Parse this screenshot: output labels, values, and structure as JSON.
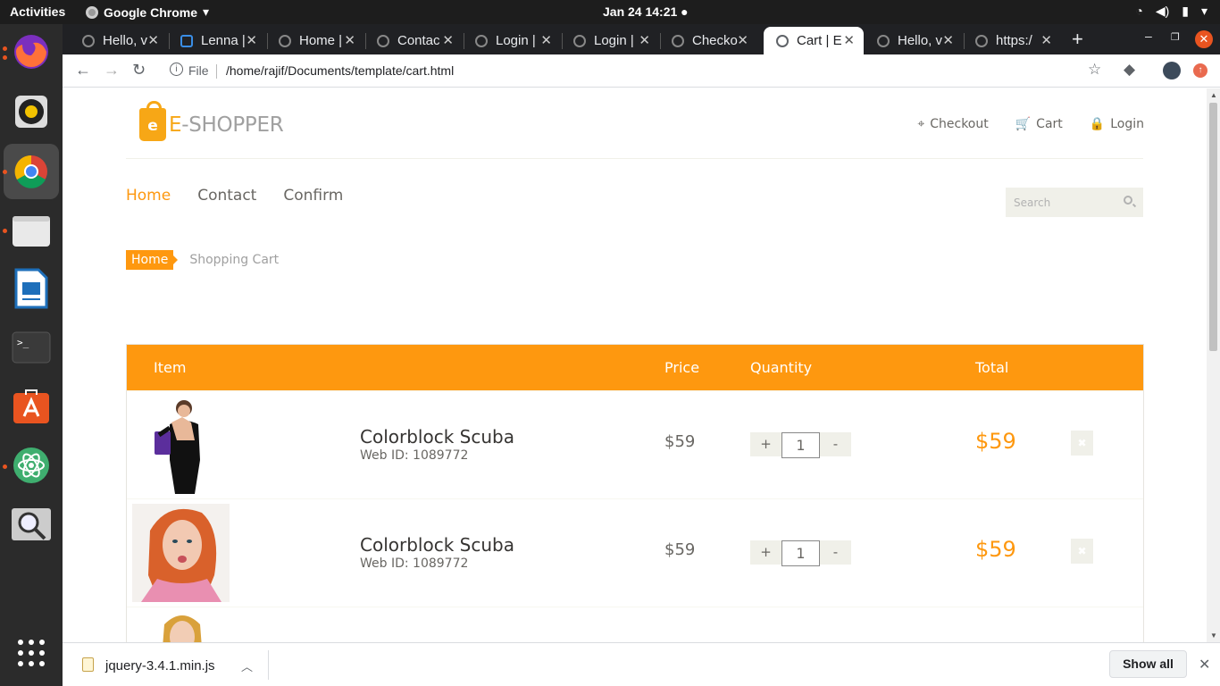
{
  "os": {
    "activities": "Activities",
    "app_name": "Google Chrome",
    "clock": "Jan 24  14:21"
  },
  "browser": {
    "tabs": [
      {
        "label": "Hello, v"
      },
      {
        "label": "Lenna |"
      },
      {
        "label": "Home |"
      },
      {
        "label": "Contac"
      },
      {
        "label": "Login |"
      },
      {
        "label": "Login |"
      },
      {
        "label": "Checko"
      },
      {
        "label": "Cart | E"
      },
      {
        "label": "Hello, v"
      },
      {
        "label": "https:/"
      }
    ],
    "active_tab_index": 7,
    "omnibox_scheme": "File",
    "url": "/home/rajif/Documents/template/cart.html"
  },
  "site": {
    "logo_letter": "e",
    "brand_first": "E",
    "brand_rest": "-SHOPPER",
    "shop_menu": {
      "checkout": "Checkout",
      "cart": "Cart",
      "login": "Login"
    },
    "main_menu": {
      "home": "Home",
      "contact": "Contact",
      "confirm": "Confirm"
    },
    "search_placeholder": "Search",
    "breadcrumb": {
      "home": "Home",
      "current": "Shopping Cart"
    },
    "accent_color": "#fe980f"
  },
  "cart": {
    "headers": {
      "item": "Item",
      "price": "Price",
      "quantity": "Quantity",
      "total": "Total"
    },
    "rows": [
      {
        "name": "Colorblock Scuba",
        "web_id": "Web ID: 1089772",
        "price": "$59",
        "qty": "1",
        "total": "$59",
        "plus": "+",
        "minus": "-"
      },
      {
        "name": "Colorblock Scuba",
        "web_id": "Web ID: 1089772",
        "price": "$59",
        "qty": "1",
        "total": "$59",
        "plus": "+",
        "minus": "-"
      }
    ]
  },
  "downloads": {
    "file": "jquery-3.4.1.min.js",
    "show_all": "Show all"
  }
}
